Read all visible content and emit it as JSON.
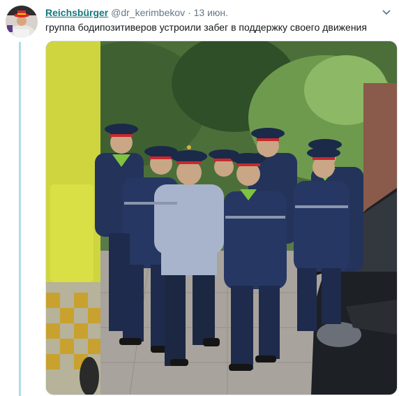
{
  "tweet": {
    "author_name": "Reichsbürger",
    "handle": "@dr_kerimbekov",
    "separator": "·",
    "date": "13 июн.",
    "text": "группа бодипозитиверов устроили забег в поддержку своего движения"
  },
  "icons": {
    "avatar": "avatar-photo",
    "menu": "chevron-down-icon"
  },
  "media": {
    "description_kind": "photo",
    "colors": {
      "uniform": "#23335a",
      "shirt": "#a8b4cc",
      "cap_band": "#c8282d",
      "vest_green": "#7fc340",
      "van": "#cfd53f",
      "car": "#1d2024",
      "foliage": "#4c6f3a",
      "pavement": "#a9a39d"
    }
  },
  "colors": {
    "author": "#14777e",
    "muted": "#657786",
    "thread_line": "#aedcea"
  }
}
